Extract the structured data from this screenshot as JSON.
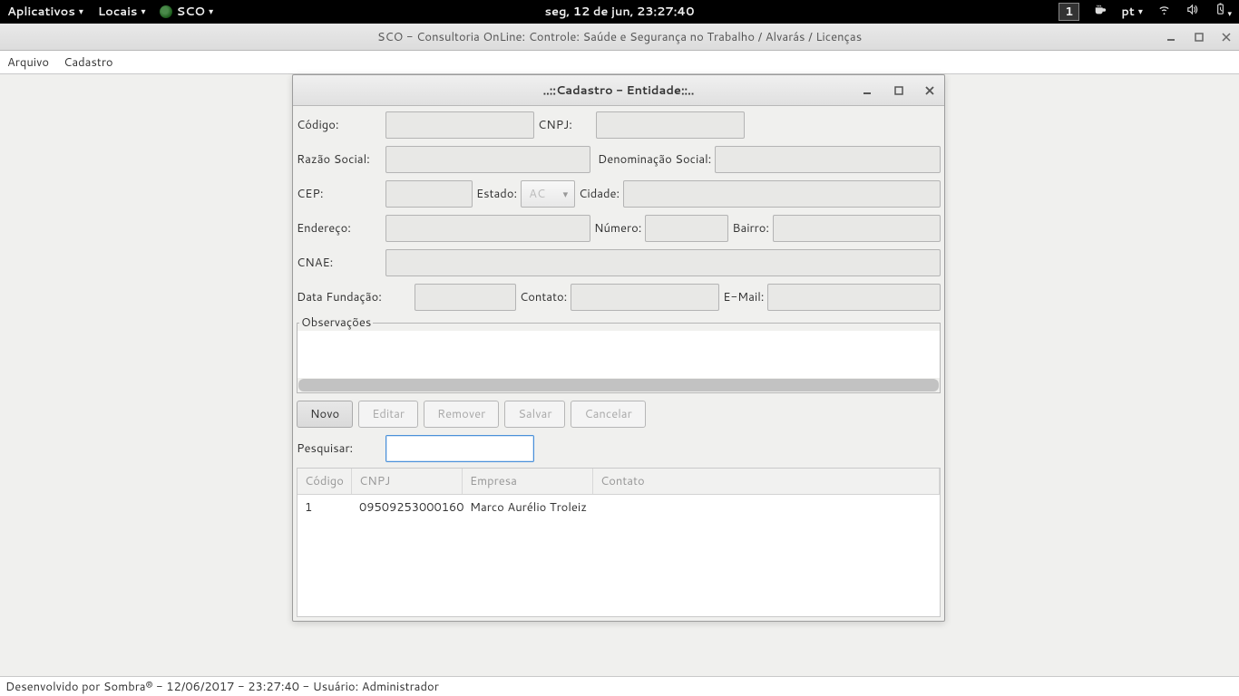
{
  "panel": {
    "applications": "Aplicativos",
    "places": "Locais",
    "app": "SCO",
    "clock": "seg, 12 de jun, 23:27:40",
    "workspace": "1",
    "keyboard": "pt"
  },
  "window": {
    "title": "SCO - Consultoria OnLine: Controle: Saúde e Segurança no Trabalho / Alvarás / Licenças",
    "menu": {
      "arquivo": "Arquivo",
      "cadastro": "Cadastro"
    },
    "status": "Desenvolvido por Sombra® - 12/06/2017 - 23:27:40 - Usuário: Administrador"
  },
  "dialog": {
    "title": "..::Cadastro - Entidade::..",
    "labels": {
      "codigo": "Código:",
      "cnpj": "CNPJ:",
      "razao": "Razão Social:",
      "denominacao": "Denominação Social:",
      "cep": "CEP:",
      "estado": "Estado:",
      "cidade": "Cidade:",
      "endereco": "Endereço:",
      "numero": "Número:",
      "bairro": "Bairro:",
      "cnae": "CNAE:",
      "fundacao": "Data Fundação:",
      "contato": "Contato:",
      "email": "E-Mail:",
      "observacoes": "Observações",
      "pesquisar": "Pesquisar:"
    },
    "estado_value": "AC",
    "buttons": {
      "novo": "Novo",
      "editar": "Editar",
      "remover": "Remover",
      "salvar": "Salvar",
      "cancelar": "Cancelar"
    },
    "table": {
      "headers": {
        "codigo": "Código",
        "cnpj": "CNPJ",
        "empresa": "Empresa",
        "contato": "Contato"
      },
      "rows": [
        {
          "codigo": "1",
          "cnpj": "09509253000160",
          "empresa": "Marco Aurélio Troleiz",
          "contato": ""
        }
      ]
    }
  }
}
